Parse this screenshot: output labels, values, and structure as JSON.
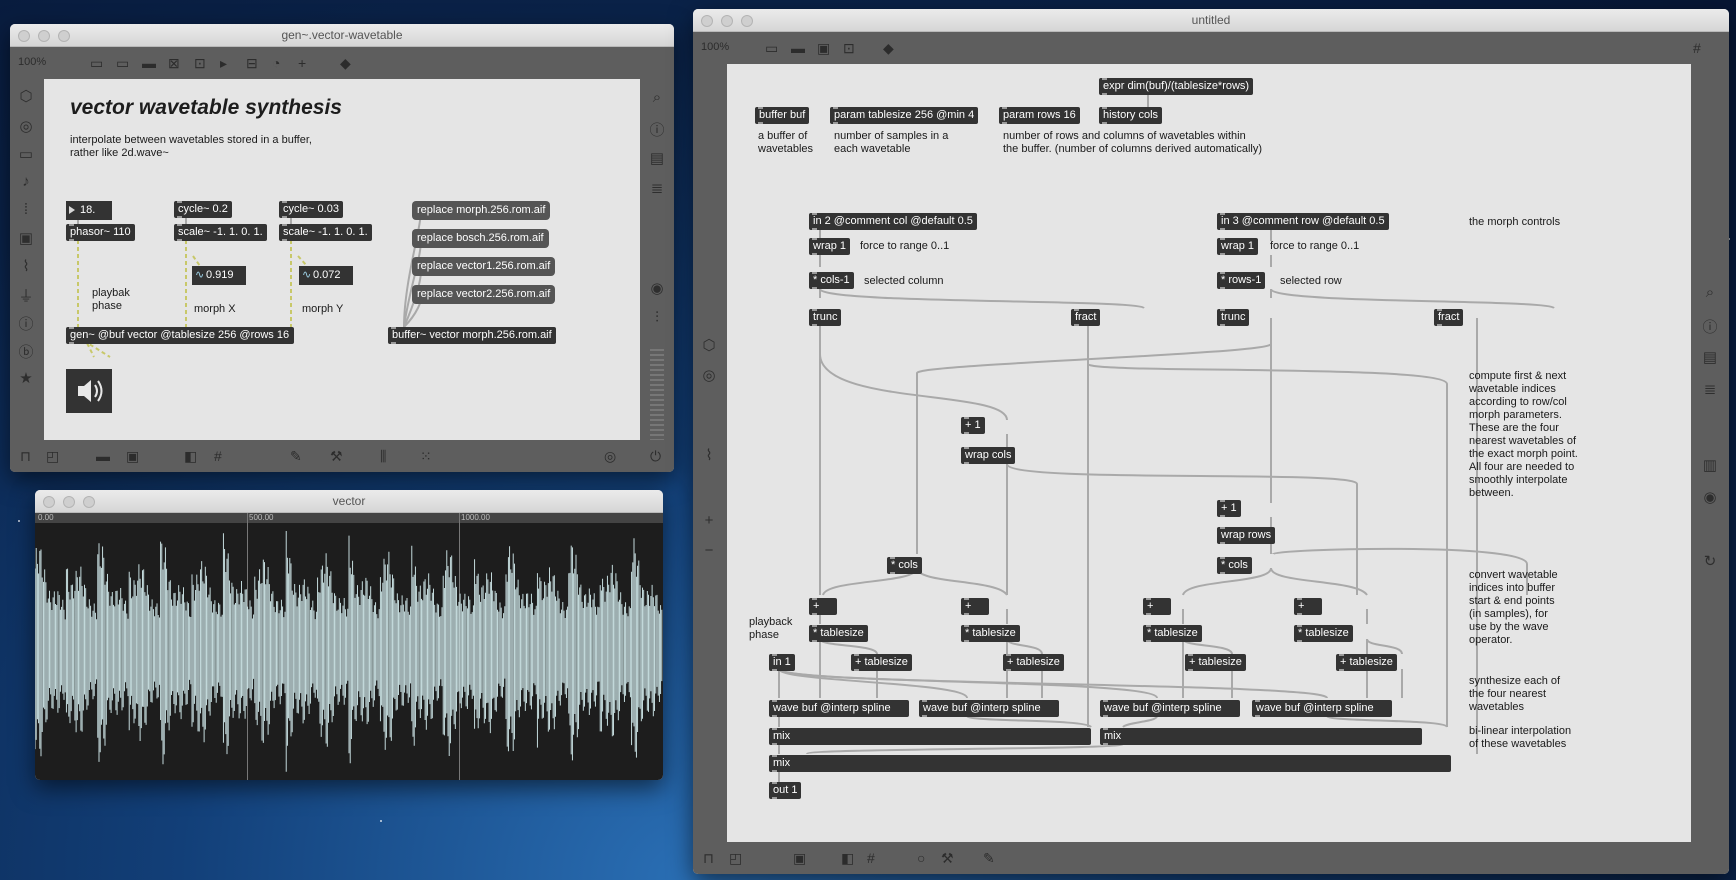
{
  "windows": {
    "gen": {
      "title": "gen~.vector-wavetable",
      "zoom": "100%",
      "heading": "vector wavetable synthesis",
      "description": "interpolate between wavetables stored in a buffer,\nrather like 2d.wave~",
      "objects": {
        "number_box": "18.",
        "phasor": "phasor~ 110",
        "cycle_x": "cycle~ 0.2",
        "scale_x": "scale~ -1. 1. 0. 1.",
        "scope_x": "0.919",
        "cycle_y": "cycle~ 0.03",
        "scale_y": "scale~ -1. 1. 0. 1.",
        "scope_y": "0.072",
        "gen": "gen~ @buf vector @tablesize 256 @rows 16",
        "buffer": "buffer~ vector morph.256.rom.aif"
      },
      "messages": [
        "replace morph.256.rom.aif",
        "replace bosch.256.rom.aif",
        "replace vector1.256.rom.aif",
        "replace vector2.256.rom.aif"
      ],
      "comments": {
        "playback": "playbak\nphase",
        "morph_x": "morph X",
        "morph_y": "morph Y"
      }
    },
    "vector": {
      "title": "vector",
      "ruler": [
        "0.00",
        "500.00",
        "1000.00"
      ]
    },
    "untitled": {
      "title": "untitled",
      "zoom": "100%",
      "objects": {
        "buffer_buf": "buffer buf",
        "param_tablesize": "param tablesize 256 @min 4",
        "param_rows": "param rows 16",
        "expr": "expr dim(buf)/(tablesize*rows)",
        "history_cols": "history cols",
        "in2": "in 2 @comment col @default 0.5",
        "in3": "in 3 @comment row @default 0.5",
        "wrap1a": "wrap 1",
        "wrap1b": "wrap 1",
        "cols1": "* cols-1",
        "rows1": "* rows-1",
        "trunc_a": "trunc",
        "fract_a": "fract",
        "trunc_b": "trunc",
        "fract_b": "fract",
        "plus1_a": "+ 1",
        "wrapcols": "wrap cols",
        "plus1_b": "+ 1",
        "wraprows": "wrap rows",
        "mulcols_a": "* cols",
        "mulcols_b": "* cols",
        "plus_1": "+",
        "plus_2": "+",
        "plus_3": "+",
        "plus_4": "+",
        "mt_1": "* tablesize",
        "mt_2": "* tablesize",
        "mt_3": "* tablesize",
        "mt_4": "* tablesize",
        "in1": "in 1",
        "pt_1": "+ tablesize",
        "pt_2": "+ tablesize",
        "pt_3": "+ tablesize",
        "pt_4": "+ tablesize",
        "wave_1": "wave buf @interp spline",
        "wave_2": "wave buf @interp spline",
        "wave_3": "wave buf @interp spline",
        "wave_4": "wave buf @interp spline",
        "mix_1": "mix",
        "mix_2": "mix",
        "mix_3": "mix",
        "out1": "out 1"
      },
      "comments": {
        "buffer_desc": "a buffer of\nwavetables",
        "tablesize_desc": "number of samples in a\neach wavetable",
        "rows_desc": "number of rows and columns of wavetables within\nthe buffer. (number of columns derived automatically)",
        "morph_controls": "the morph controls",
        "force_a": "force to range 0..1",
        "force_b": "force to range 0..1",
        "sel_col": "selected column",
        "sel_row": "selected row",
        "compute": "compute first & next\nwavetable indices\naccording to row/col\nmorph parameters.\nThese are the four\nnearest wavetables of\nthe exact morph point.\nAll four are needed to\nsmoothly interpolate\nbetween.",
        "convert": "convert wavetable\nindices into buffer\nstart & end points\n(in samples), for\nuse by the wave\noperator.",
        "playback_phase": "playback\nphase",
        "synth": "synthesize each of\nthe four nearest\nwavetables",
        "bilinear": "bi-linear interpolation\nof these wavetables"
      }
    }
  },
  "colors": {
    "object_bg": "#333333",
    "message_bg": "#555555",
    "canvas_bg": "#e5e5e5",
    "cord_signal": "#c8c869",
    "cord_gray": "#a9a9a9",
    "waveform": "#d5eef0"
  }
}
